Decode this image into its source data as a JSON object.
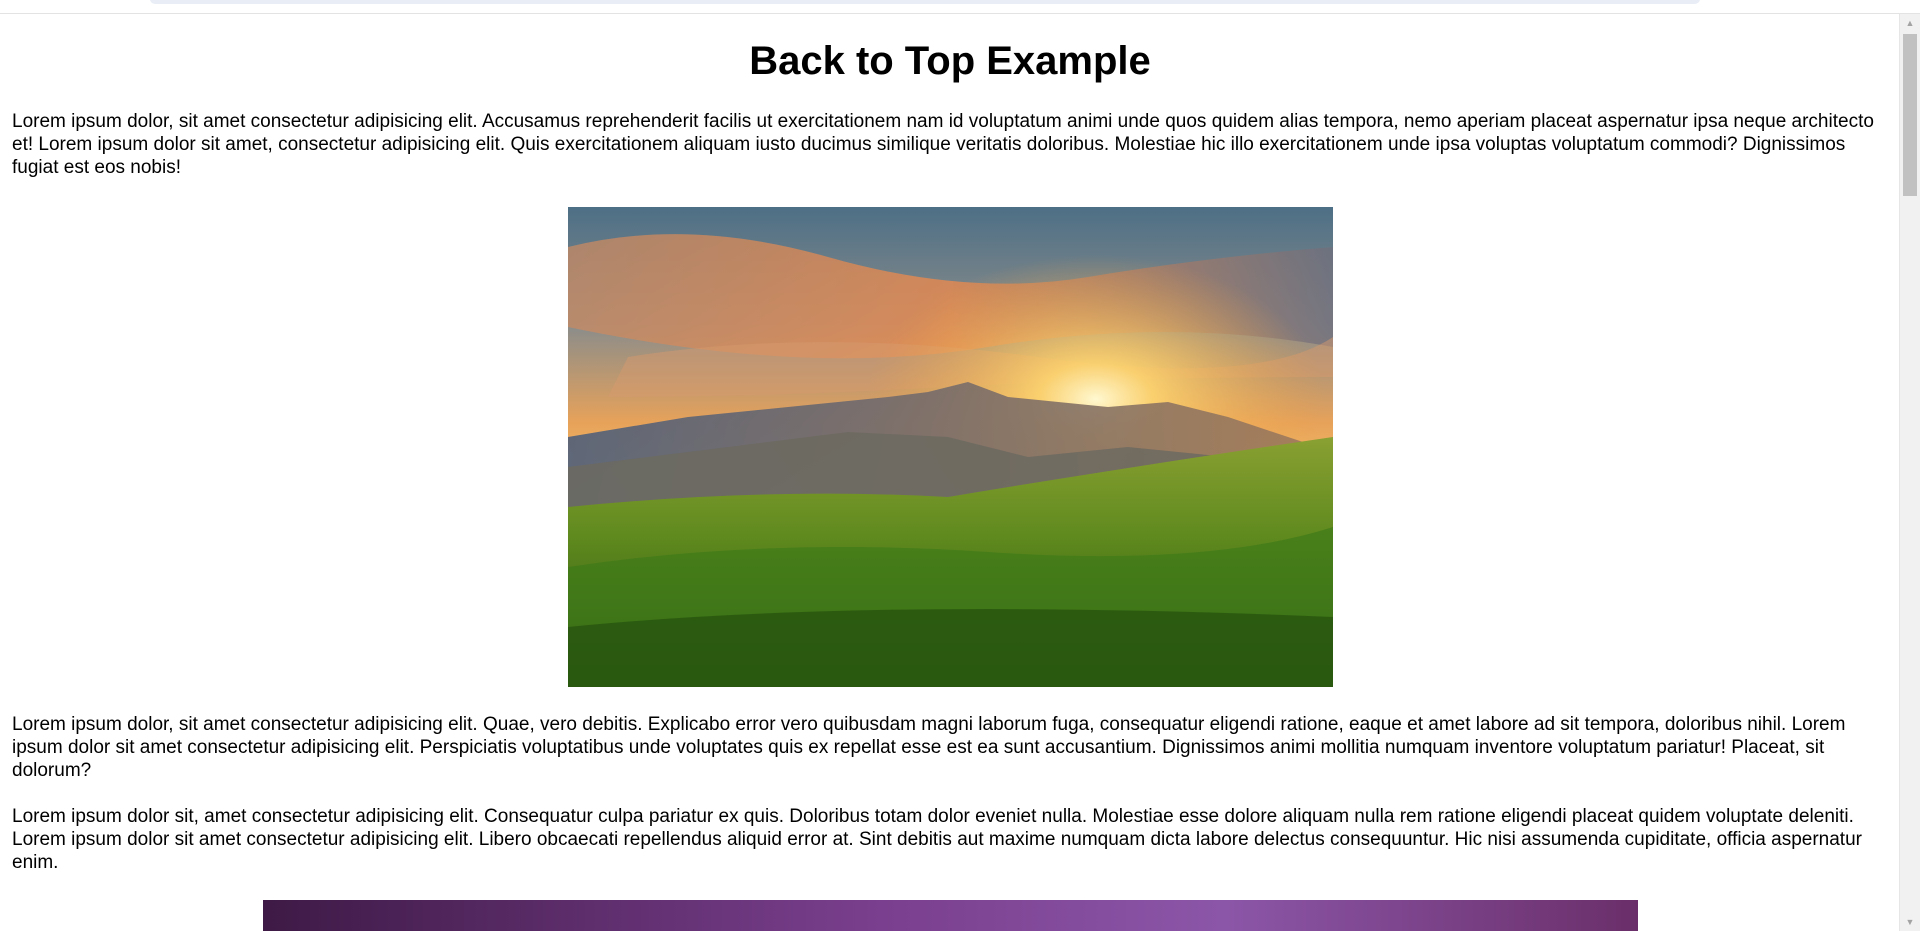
{
  "page": {
    "title": "Back to Top Example",
    "paragraphs": [
      "Lorem ipsum dolor, sit amet consectetur adipisicing elit. Accusamus reprehenderit facilis ut exercitationem nam id voluptatum animi unde quos quidem alias tempora, nemo aperiam placeat aspernatur ipsa neque architecto et! Lorem ipsum dolor sit amet, consectetur adipisicing elit. Quis exercitationem aliquam iusto ducimus similique veritatis doloribus. Molestiae hic illo exercitationem unde ipsa voluptas voluptatum commodi? Dignissimos fugiat est eos nobis!",
      "Lorem ipsum dolor, sit amet consectetur adipisicing elit. Quae, vero debitis. Explicabo error vero quibusdam magni laborum fuga, consequatur eligendi ratione, eaque et amet labore ad sit tempora, doloribus nihil. Lorem ipsum dolor sit amet consectetur adipisicing elit. Perspiciatis voluptatibus unde voluptates quis ex repellat esse est ea sunt accusantium. Dignissimos animi mollitia numquam inventore voluptatum pariatur! Placeat, sit dolorum?",
      "Lorem ipsum dolor sit, amet consectetur adipisicing elit. Consequatur culpa pariatur ex quis. Doloribus totam dolor eveniet nulla. Molestiae esse dolore aliquam nulla rem ratione eligendi placeat quidem voluptate deleniti. Lorem ipsum dolor sit amet consectetur adipisicing elit. Libero obcaecati repellendus aliquid error at. Sint debitis aut maxime numquam dicta labore delectus consequuntur. Hic nisi assumenda cupiditate, officia aspernatur enim."
    ]
  },
  "images": [
    {
      "subject": "mountain-sunset-meadow",
      "colors": [
        "#e98a3a",
        "#5a86a0",
        "#7a9a2a",
        "#2f5a14"
      ]
    },
    {
      "subject": "purple-sky",
      "colors": [
        "#4a1f55",
        "#8a4a9e",
        "#6a3a8a"
      ]
    }
  ],
  "scrollbar": {
    "position_fraction": 0.0,
    "up_icon": "triangle-up-icon",
    "down_icon": "triangle-down-icon"
  }
}
